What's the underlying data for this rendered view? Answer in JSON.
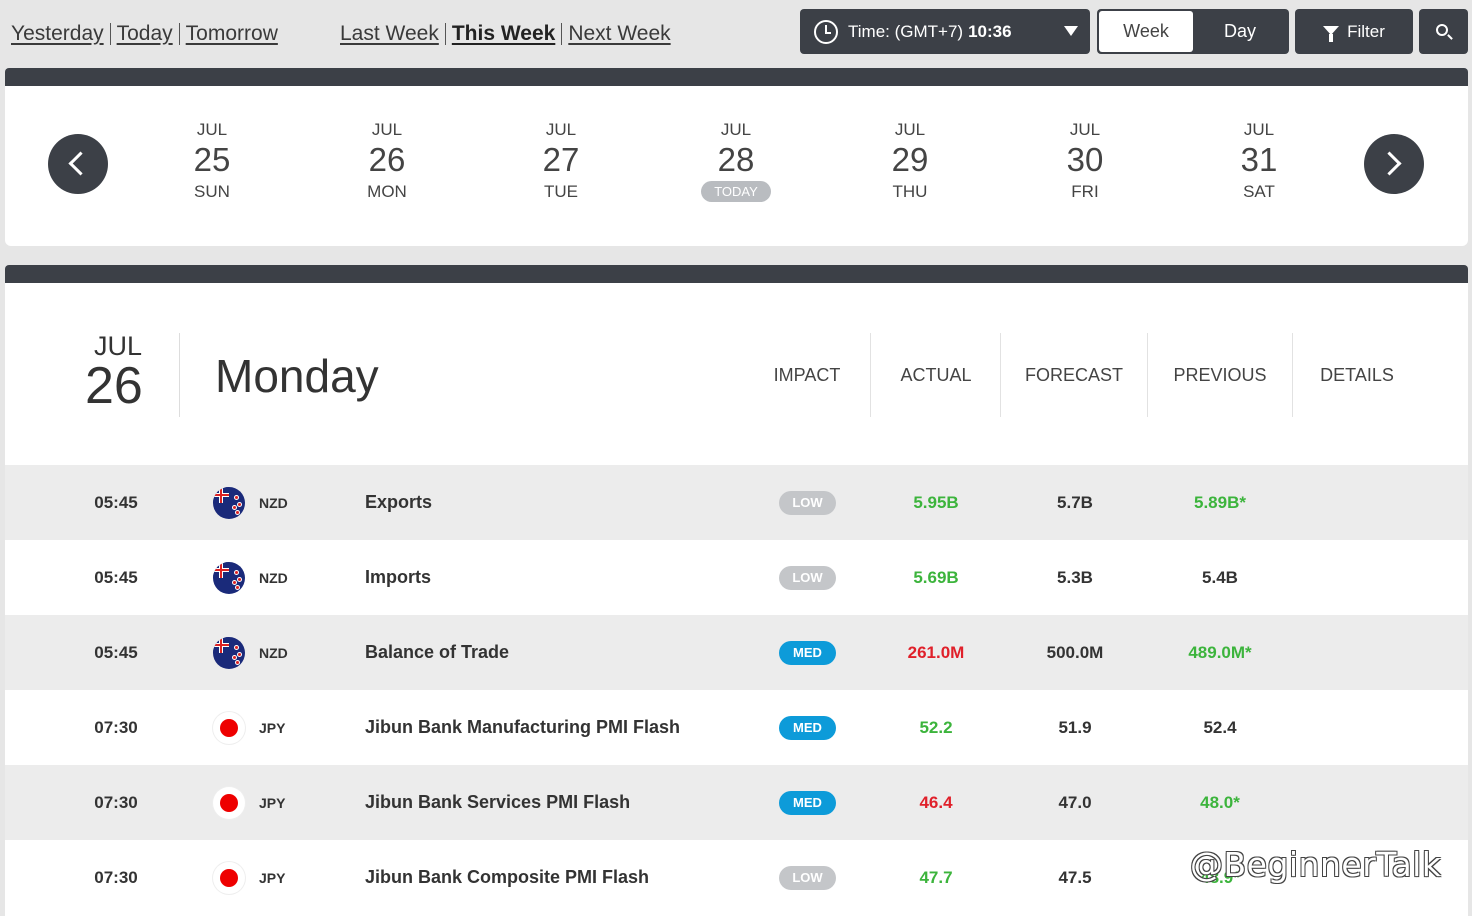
{
  "quick_links": {
    "days": [
      {
        "label": "Yesterday",
        "active": false
      },
      {
        "label": "Today",
        "active": false
      },
      {
        "label": "Tomorrow",
        "active": false
      }
    ],
    "weeks": [
      {
        "label": "Last Week",
        "active": false
      },
      {
        "label": "This Week",
        "active": true
      },
      {
        "label": "Next Week",
        "active": false
      }
    ]
  },
  "toolbar": {
    "time_label": "Time: (GMT+7)",
    "time_value": "10:36",
    "view_week": "Week",
    "view_day": "Day",
    "active_view": "Week",
    "filter_label": "Filter"
  },
  "week_strip": {
    "days": [
      {
        "month": "JUL",
        "date": "25",
        "weekday": "SUN"
      },
      {
        "month": "JUL",
        "date": "26",
        "weekday": "MON"
      },
      {
        "month": "JUL",
        "date": "27",
        "weekday": "TUE"
      },
      {
        "month": "JUL",
        "date": "28",
        "weekday": "TODAY"
      },
      {
        "month": "JUL",
        "date": "29",
        "weekday": "THU"
      },
      {
        "month": "JUL",
        "date": "30",
        "weekday": "FRI"
      },
      {
        "month": "JUL",
        "date": "31",
        "weekday": "SAT"
      }
    ]
  },
  "day_section": {
    "month": "JUL",
    "date": "26",
    "weekday": "Monday",
    "columns": {
      "impact": "IMPACT",
      "actual": "ACTUAL",
      "forecast": "FORECAST",
      "previous": "PREVIOUS",
      "details": "DETAILS"
    },
    "events": [
      {
        "time": "05:45",
        "flag": "nz-flag-icon",
        "currency": "NZD",
        "event": "Exports",
        "impact": "LOW",
        "actual": "5.95B",
        "actual_trend": "pos",
        "forecast": "5.7B",
        "previous": "5.89B*",
        "previous_trend": "pos"
      },
      {
        "time": "05:45",
        "flag": "nz-flag-icon",
        "currency": "NZD",
        "event": "Imports",
        "impact": "LOW",
        "actual": "5.69B",
        "actual_trend": "pos",
        "forecast": "5.3B",
        "previous": "5.4B",
        "previous_trend": "neu"
      },
      {
        "time": "05:45",
        "flag": "nz-flag-icon",
        "currency": "NZD",
        "event": "Balance of Trade",
        "impact": "MED",
        "actual": "261.0M",
        "actual_trend": "neg",
        "forecast": "500.0M",
        "previous": "489.0M*",
        "previous_trend": "pos"
      },
      {
        "time": "07:30",
        "flag": "jp-flag-icon",
        "currency": "JPY",
        "event": "Jibun Bank Manufacturing PMI Flash",
        "impact": "MED",
        "actual": "52.2",
        "actual_trend": "pos",
        "forecast": "51.9",
        "previous": "52.4",
        "previous_trend": "neu"
      },
      {
        "time": "07:30",
        "flag": "jp-flag-icon",
        "currency": "JPY",
        "event": "Jibun Bank Services PMI Flash",
        "impact": "MED",
        "actual": "46.4",
        "actual_trend": "neg",
        "forecast": "47.0",
        "previous": "48.0*",
        "previous_trend": "pos"
      },
      {
        "time": "07:30",
        "flag": "jp-flag-icon",
        "currency": "JPY",
        "event": "Jibun Bank Composite PMI Flash",
        "impact": "LOW",
        "actual": "47.7",
        "actual_trend": "pos",
        "forecast": "47.5",
        "previous": "48.9*",
        "previous_trend": "pos"
      }
    ]
  },
  "watermark": "@BeginnerTalk",
  "colors": {
    "dark": "#3c4047",
    "positive": "#3cb43c",
    "negative": "#e0202a",
    "impact_low": "#c4c6c9",
    "impact_med": "#0d9bd9"
  }
}
